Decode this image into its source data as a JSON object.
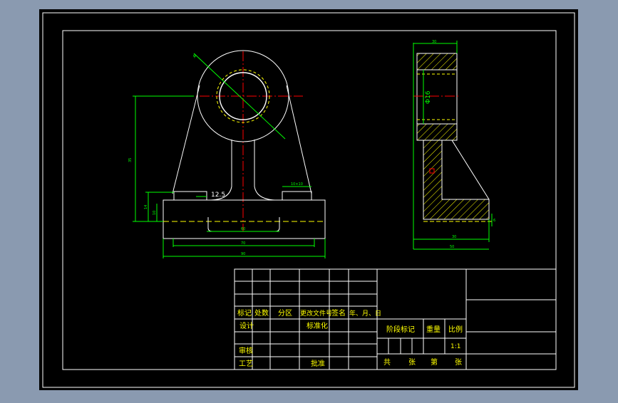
{
  "colors": {
    "background": "#8a9ab0",
    "sheet": "#000000",
    "frame": "#ffffff",
    "part_outline": "#ffffff",
    "dimension": "#00ff00",
    "centerline": "#ff0000",
    "hidden_line": "#ffff00",
    "hatch": "#ffff00",
    "title_text": "#ffff00"
  },
  "front_view": {
    "label_wall_thickness": "12.5",
    "label_slot": "10×10",
    "label_left_height": "35",
    "label_left_small": "14",
    "label_inner": "10",
    "label_slot_width": "60",
    "label_base_inner": "70",
    "label_base_total": "90",
    "label_bore": "φ"
  },
  "side_view": {
    "label_bore_diameter": "Φ16",
    "label_top_width": "30",
    "label_bottom_width": "50",
    "label_base_height": "6"
  },
  "title_block": {
    "col_marker": "标记",
    "col_count": "处数",
    "col_zone": "分区",
    "col_change_doc": "更改文件号",
    "col_signature": "签名",
    "col_date": "年、月、日",
    "design": "设计",
    "standardize": "标准化",
    "review": "审核",
    "process": "工艺",
    "approve": "批准",
    "stage_mark": "阶段标记",
    "weight": "重量",
    "scale": "比例",
    "scale_value": "1:1",
    "total": "共",
    "sheets": "张",
    "sheet_no": "第",
    "sheet_unit": "张"
  }
}
